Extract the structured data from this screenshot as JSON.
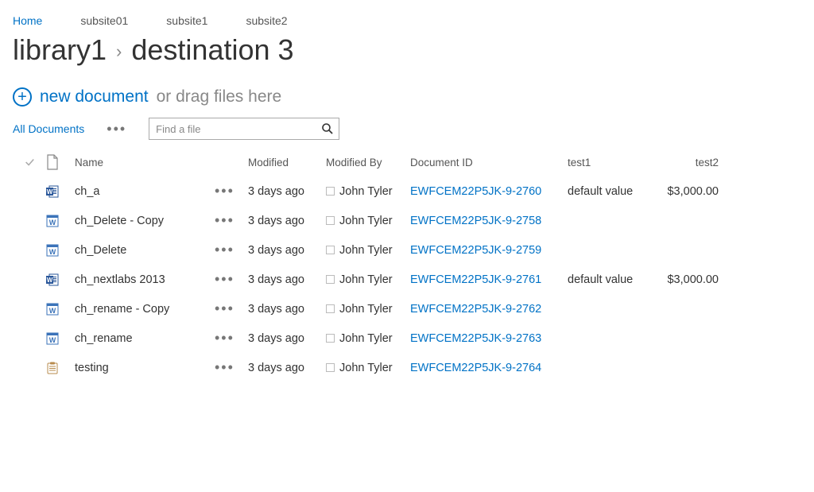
{
  "topnav": [
    {
      "label": "Home",
      "active": true
    },
    {
      "label": "subsite01",
      "active": false
    },
    {
      "label": "subsite1",
      "active": false
    },
    {
      "label": "subsite2",
      "active": false
    }
  ],
  "title": {
    "library": "library1",
    "folder": "destination 3"
  },
  "newdoc": {
    "link": "new document",
    "hint": "or drag files here"
  },
  "toolbar": {
    "alldocs": "All Documents"
  },
  "search": {
    "placeholder": "Find a file"
  },
  "columns": {
    "name": "Name",
    "modified": "Modified",
    "modifiedby": "Modified By",
    "docid": "Document ID",
    "test1": "test1",
    "test2": "test2"
  },
  "rows": [
    {
      "icon": "wordx",
      "name": "ch_a",
      "modified": "3 days ago",
      "by": "John Tyler",
      "docid": "EWFCEM22P5JK-9-2760",
      "test1": "default value",
      "test2": "$3,000.00"
    },
    {
      "icon": "word",
      "name": "ch_Delete - Copy",
      "modified": "3 days ago",
      "by": "John Tyler",
      "docid": "EWFCEM22P5JK-9-2758",
      "test1": "",
      "test2": ""
    },
    {
      "icon": "word",
      "name": "ch_Delete",
      "modified": "3 days ago",
      "by": "John Tyler",
      "docid": "EWFCEM22P5JK-9-2759",
      "test1": "",
      "test2": ""
    },
    {
      "icon": "wordx",
      "name": "ch_nextlabs 2013",
      "modified": "3 days ago",
      "by": "John Tyler",
      "docid": "EWFCEM22P5JK-9-2761",
      "test1": "default value",
      "test2": "$3,000.00"
    },
    {
      "icon": "word",
      "name": "ch_rename - Copy",
      "modified": "3 days ago",
      "by": "John Tyler",
      "docid": "EWFCEM22P5JK-9-2762",
      "test1": "",
      "test2": ""
    },
    {
      "icon": "word",
      "name": "ch_rename",
      "modified": "3 days ago",
      "by": "John Tyler",
      "docid": "EWFCEM22P5JK-9-2763",
      "test1": "",
      "test2": ""
    },
    {
      "icon": "clip",
      "name": "testing",
      "modified": "3 days ago",
      "by": "John Tyler",
      "docid": "EWFCEM22P5JK-9-2764",
      "test1": "",
      "test2": ""
    }
  ]
}
